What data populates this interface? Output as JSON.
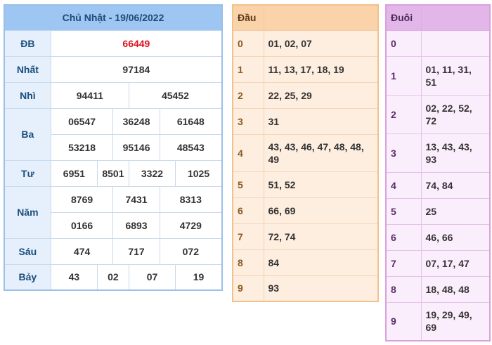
{
  "results": {
    "title": "Chủ Nhật - 19/06/2022",
    "db": {
      "label": "ĐB",
      "value": "66449"
    },
    "nhat": {
      "label": "Nhất",
      "value": "97184"
    },
    "nhi": {
      "label": "Nhì",
      "values": [
        "94411",
        "45452"
      ]
    },
    "ba": {
      "label": "Ba",
      "values": [
        "06547",
        "36248",
        "61648",
        "53218",
        "95146",
        "48543"
      ]
    },
    "tu": {
      "label": "Tư",
      "values": [
        "6951",
        "8501",
        "3322",
        "1025"
      ]
    },
    "nam": {
      "label": "Năm",
      "values": [
        "8769",
        "7431",
        "8313",
        "0166",
        "6893",
        "4729"
      ]
    },
    "sau": {
      "label": "Sáu",
      "values": [
        "474",
        "717",
        "072"
      ]
    },
    "bay": {
      "label": "Bảy",
      "values": [
        "43",
        "02",
        "07",
        "19"
      ]
    }
  },
  "dau": {
    "header": "Đầu",
    "rows": [
      {
        "key": "0",
        "value": "01, 02, 07"
      },
      {
        "key": "1",
        "value": "11, 13, 17, 18, 19"
      },
      {
        "key": "2",
        "value": "22, 25, 29"
      },
      {
        "key": "3",
        "value": "31"
      },
      {
        "key": "4",
        "value": "43, 43, 46, 47, 48, 48, 49"
      },
      {
        "key": "5",
        "value": "51, 52"
      },
      {
        "key": "6",
        "value": "66, 69"
      },
      {
        "key": "7",
        "value": "72, 74"
      },
      {
        "key": "8",
        "value": "84"
      },
      {
        "key": "9",
        "value": "93"
      }
    ]
  },
  "duoi": {
    "header": "Đuôi",
    "rows": [
      {
        "key": "0",
        "value": ""
      },
      {
        "key": "1",
        "value": "01, 11, 31, 51"
      },
      {
        "key": "2",
        "value": "02, 22, 52, 72"
      },
      {
        "key": "3",
        "value": "13, 43, 43, 93"
      },
      {
        "key": "4",
        "value": "74, 84"
      },
      {
        "key": "5",
        "value": "25"
      },
      {
        "key": "6",
        "value": "46, 66"
      },
      {
        "key": "7",
        "value": "07, 17, 47"
      },
      {
        "key": "8",
        "value": "18, 48, 48"
      },
      {
        "key": "9",
        "value": "19, 29, 49, 69"
      }
    ]
  },
  "colors": {
    "special_prize": "#e0101a",
    "results_header": "#9dc6f2",
    "dau_header": "#fbd3aa",
    "duoi_header": "#e3b6ea"
  }
}
